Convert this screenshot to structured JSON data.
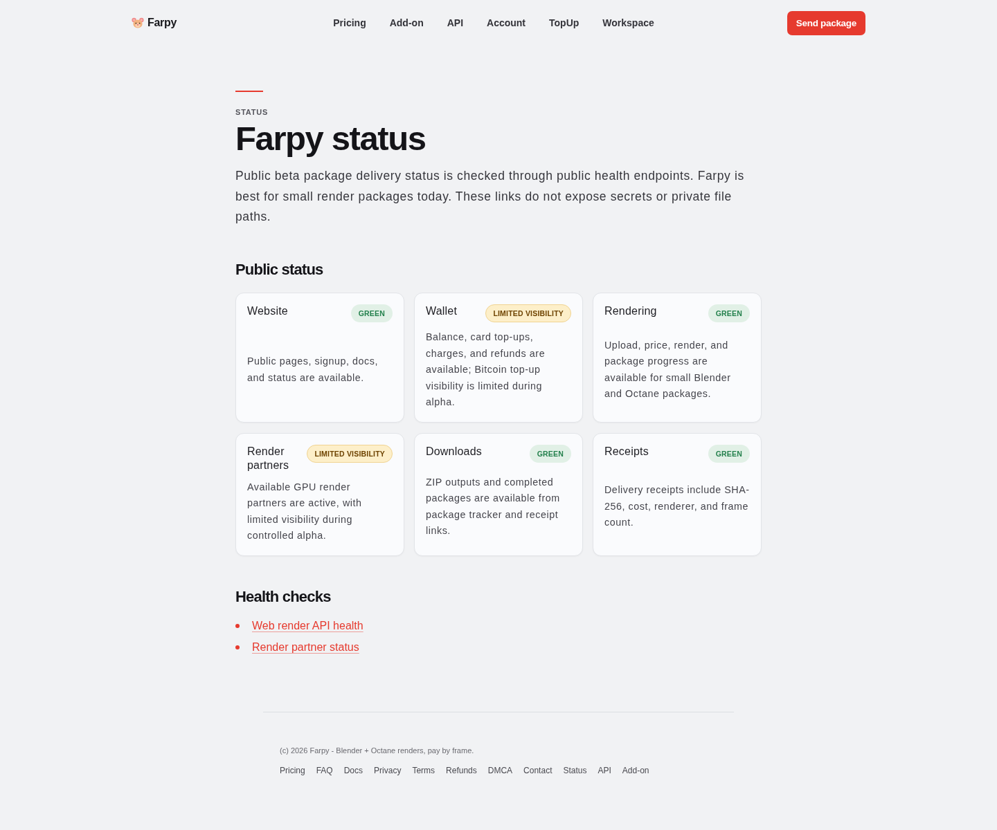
{
  "nav": {
    "brand": "Farpy",
    "links": [
      "Pricing",
      "Add-on",
      "API",
      "Account",
      "TopUp",
      "Workspace"
    ],
    "cta": "Send package"
  },
  "hero": {
    "eyebrow": "STATUS",
    "title": "Farpy status",
    "intro": "Public beta package delivery status is checked through public health endpoints. Farpy is best for small render packages today. These links do not expose secrets or private file paths."
  },
  "public_status": {
    "heading": "Public status",
    "cards": [
      {
        "title": "Website",
        "badge": {
          "label": "GREEN",
          "kind": "green"
        },
        "description": "Public pages, signup, docs, and status are available."
      },
      {
        "title": "Wallet",
        "badge": {
          "label": "LIMITED VISIBILITY",
          "kind": "limited"
        },
        "description": "Balance, card top-ups, charges, and refunds are available; Bitcoin top-up visibility is limited during alpha."
      },
      {
        "title": "Rendering",
        "badge": {
          "label": "GREEN",
          "kind": "green"
        },
        "description": "Upload, price, render, and package progress are available for small Blender and Octane packages."
      },
      {
        "title": "Render partners",
        "badge": {
          "label": "LIMITED VISIBILITY",
          "kind": "limited"
        },
        "description": "Available GPU render partners are active, with limited visibility during controlled alpha."
      },
      {
        "title": "Downloads",
        "badge": {
          "label": "GREEN",
          "kind": "green"
        },
        "description": "ZIP outputs and completed packages are available from package tracker and receipt links."
      },
      {
        "title": "Receipts",
        "badge": {
          "label": "GREEN",
          "kind": "green"
        },
        "description": "Delivery receipts include SHA-256, cost, renderer, and frame count."
      }
    ]
  },
  "health_checks": {
    "heading": "Health checks",
    "links": [
      "Web render API health",
      "Render partner status"
    ]
  },
  "footer": {
    "copyright": "(c) 2026 Farpy - Blender + Octane renders, pay by frame.",
    "links": [
      "Pricing",
      "FAQ",
      "Docs",
      "Privacy",
      "Terms",
      "Refunds",
      "DMCA",
      "Contact",
      "Status",
      "API",
      "Add-on"
    ]
  }
}
